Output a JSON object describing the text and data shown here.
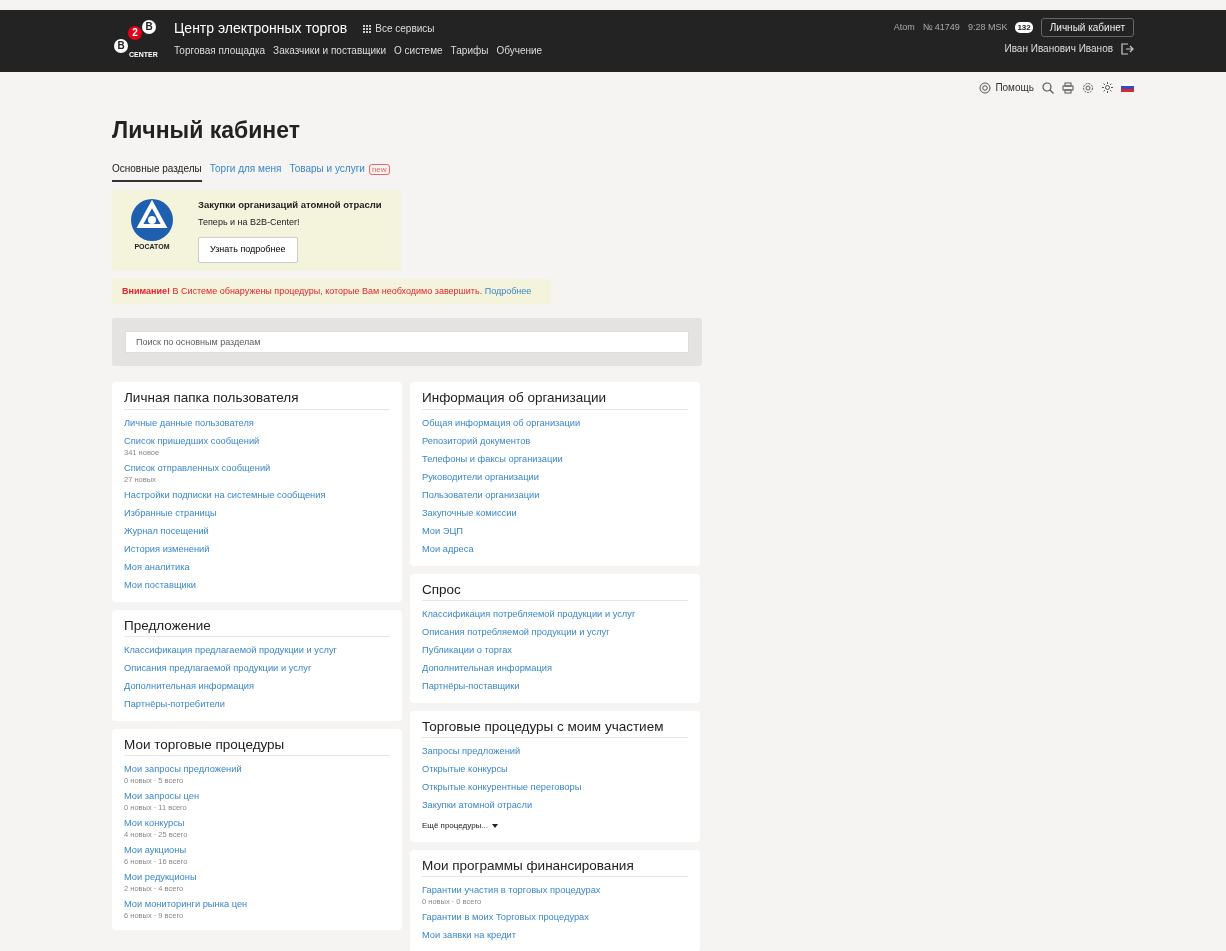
{
  "header": {
    "logo": {
      "letter_top": "B",
      "badge": "2",
      "letter_bottom": "B",
      "caption": "CENTER"
    },
    "title": "Центр электронных торгов",
    "services": "Все сервисы",
    "nav": [
      "Торговая площадка",
      "Заказчики и поставщики",
      "О системе",
      "Тарифы",
      "Обучение"
    ],
    "org": "Atom",
    "number": "№ 41749",
    "time": "9:28 MSK",
    "messages": "132",
    "account_button": "Личный кабинет",
    "user": "Иван Иванович Иванов"
  },
  "toolbar": {
    "help": "Помощь"
  },
  "page_title": "Личный кабинет",
  "tabs": [
    {
      "label": "Основные разделы",
      "selected": true
    },
    {
      "label": "Торги для меня",
      "selected": false
    },
    {
      "label": "Товары и услуги",
      "selected": false,
      "badge": "new"
    }
  ],
  "promo": {
    "logo_caption": "РОСАТОМ",
    "title": "Закупки организаций атомной отрасли",
    "text": "Теперь и на B2B-Center!",
    "button": "Узнать подробнее"
  },
  "alert": {
    "text": "**Внимание!** В Системе обнаружены процедуры, которые Вам необходимо завершить.",
    "link": "Подробнее"
  },
  "search": {
    "placeholder": "Поиск по основным разделам"
  },
  "columns": [
    [
      {
        "title": "Личная папка пользователя",
        "items": [
          {
            "label": "Личные данные пользователя"
          },
          {
            "label": "Список пришедших сообщений",
            "meta": "341 новое"
          },
          {
            "label": "Список отправленных сообщений",
            "meta": "27 новых"
          },
          {
            "label": "Настройки подписки на системные сообщения"
          },
          {
            "label": "Избранные страницы"
          },
          {
            "label": "Журнал посещений"
          },
          {
            "label": "История изменений"
          },
          {
            "label": "Моя аналитика"
          },
          {
            "label": "Мои поставщики"
          }
        ]
      },
      {
        "title": "Предложение",
        "items": [
          {
            "label": "Классификация предлагаемой продукции и услуг"
          },
          {
            "label": "Описания предлагаемой продукции и услуг"
          },
          {
            "label": "Дополнительная информация"
          },
          {
            "label": "Партнёры-потребители"
          }
        ]
      },
      {
        "title": "Мои торговые процедуры",
        "items": [
          {
            "label": "Мои запросы предложений",
            "meta": "0 новых · 5 всего"
          },
          {
            "label": "Мои запросы цен",
            "meta": "0 новых · 11 всего"
          },
          {
            "label": "Мои конкурсы",
            "meta": "4 новых · 25 всего"
          },
          {
            "label": "Мои аукционы",
            "meta": "6 новых · 16 всего"
          },
          {
            "label": "Мои редукционы",
            "meta": "2 новых · 4 всего"
          },
          {
            "label": "Мои мониторинги рынка цен",
            "meta": "6 новых · 9 всего"
          }
        ]
      }
    ],
    [
      {
        "title": "Информация об организации",
        "items": [
          {
            "label": "Общая информация об организации"
          },
          {
            "label": "Репозиторий документов"
          },
          {
            "label": "Телефоны и факсы организации"
          },
          {
            "label": "Руководители организации"
          },
          {
            "label": "Пользователи организации"
          },
          {
            "label": "Закупочные комиссии"
          },
          {
            "label": "Мои ЭЦП"
          },
          {
            "label": "Мои адреса"
          }
        ]
      },
      {
        "title": "Спрос",
        "items": [
          {
            "label": "Классификация потребляемой продукции и услуг"
          },
          {
            "label": "Описания потребляемой продукции и услуг"
          },
          {
            "label": "Публикации о торгах"
          },
          {
            "label": "Дополнительная информация"
          },
          {
            "label": "Партнёры-поставщики"
          }
        ]
      },
      {
        "title": "Торговые процедуры с моим участием",
        "items": [
          {
            "label": "Запросы предложений"
          },
          {
            "label": "Открытые конкурсы"
          },
          {
            "label": "Открытые конкурентные переговоры"
          },
          {
            "label": "Закупки атомной отрасли"
          }
        ],
        "more": "Ещё процедуры..."
      },
      {
        "title": "Мои программы финансирования",
        "items": [
          {
            "label": "Гарантии участия в торговых процедурах",
            "meta": "0 новых · 0 всего"
          },
          {
            "label": "Гарантии в моих Торговых процедурах"
          },
          {
            "label": "Мои заявки на кредит"
          }
        ]
      }
    ]
  ]
}
